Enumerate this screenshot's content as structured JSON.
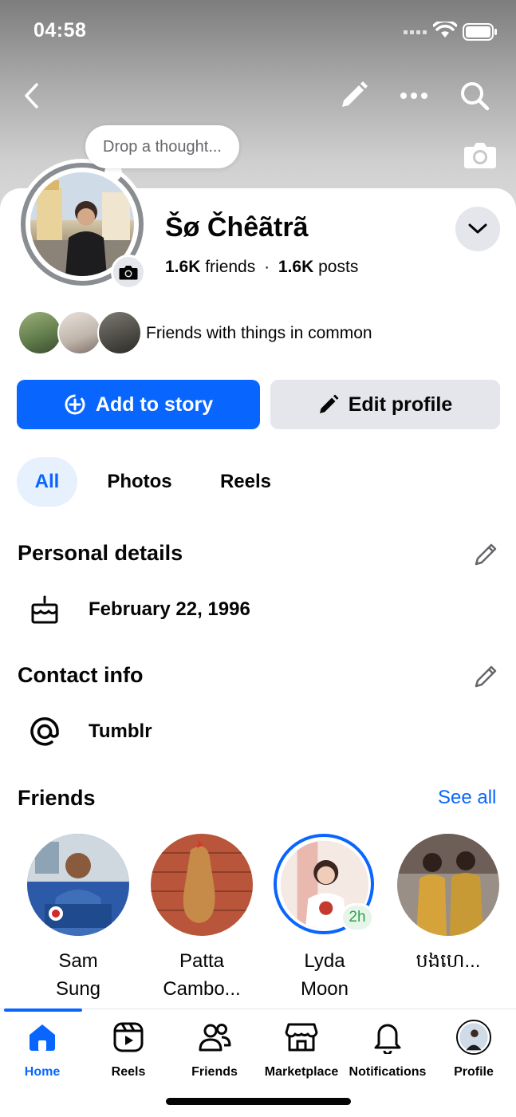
{
  "status_bar": {
    "time": "04:58"
  },
  "top_bar": {
    "back_icon": "chevron-left-icon",
    "edit_icon": "pencil-icon",
    "more_icon": "more-horizontal-icon",
    "search_icon": "search-icon"
  },
  "thought": {
    "placeholder": "Drop a thought..."
  },
  "profile": {
    "name": "Šø Čhêãtrã",
    "friends_count": "1.6K",
    "friends_word": "friends",
    "separator": "·",
    "posts_count": "1.6K",
    "posts_word": "posts",
    "mutual_text": "Friends with things in common"
  },
  "actions": {
    "add_story": "Add to story",
    "edit_profile": "Edit profile"
  },
  "tabs": [
    {
      "label": "All",
      "active": true
    },
    {
      "label": "Photos",
      "active": false
    },
    {
      "label": "Reels",
      "active": false
    }
  ],
  "personal_details": {
    "title": "Personal details",
    "birthday": "February 22, 1996"
  },
  "contact_info": {
    "title": "Contact info",
    "tumblr": "Tumblr"
  },
  "friends_section": {
    "title": "Friends",
    "see_all": "See all",
    "friends": [
      {
        "line1": "Sam",
        "line2": "Sung"
      },
      {
        "line1": "Patta",
        "line2": "Cambo..."
      },
      {
        "line1": "Lyda",
        "line2": "Moon",
        "story_badge": "2h"
      },
      {
        "line1": "បងហេ...",
        "line2": ""
      }
    ]
  },
  "bottom_nav": [
    {
      "label": "Home",
      "icon": "home-icon",
      "active": true
    },
    {
      "label": "Reels",
      "icon": "reels-icon",
      "active": false
    },
    {
      "label": "Friends",
      "icon": "friends-icon",
      "active": false
    },
    {
      "label": "Marketplace",
      "icon": "marketplace-icon",
      "active": false
    },
    {
      "label": "Notifications",
      "icon": "bell-icon",
      "active": false
    },
    {
      "label": "Profile",
      "icon": "avatar",
      "active": false
    }
  ],
  "colors": {
    "accent": "#0866ff",
    "secondary_bg": "#e4e6eb",
    "text": "#050505",
    "muted": "#65676b"
  }
}
